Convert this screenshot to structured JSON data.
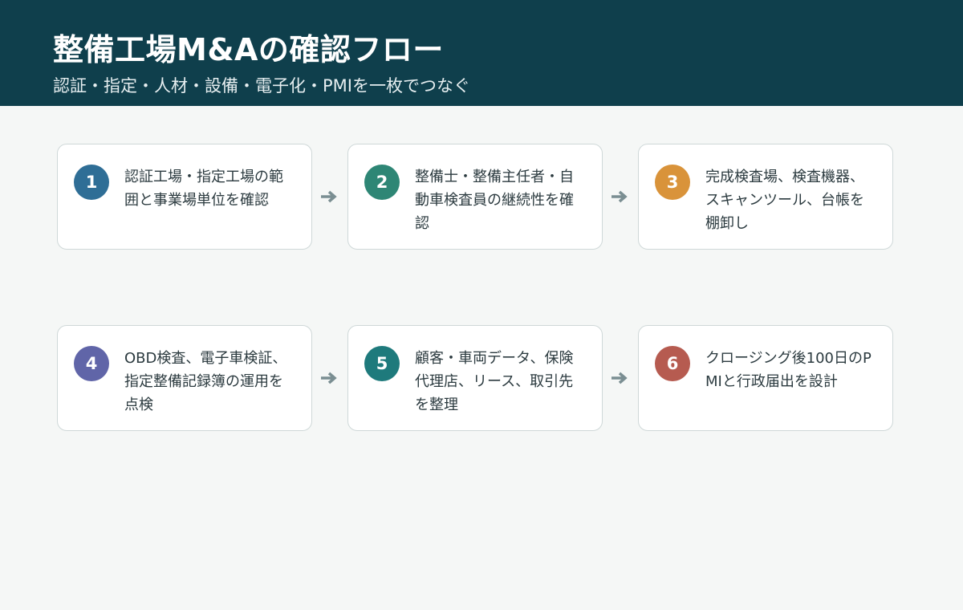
{
  "header": {
    "title": "整備工場M&Aの確認フロー",
    "subtitle": "認証・指定・人材・設備・電子化・PMIを一枚でつなぐ"
  },
  "steps": [
    {
      "number": "1",
      "text": "認証工場・指定工場の範囲と事業場単位を確認",
      "color": "#2f6e96"
    },
    {
      "number": "2",
      "text": "整備士・整備主任者・自動車検査員の継続性を確認",
      "color": "#2e8675"
    },
    {
      "number": "3",
      "text": "完成検査場、検査機器、スキャンツール、台帳を棚卸し",
      "color": "#d9933a"
    },
    {
      "number": "4",
      "text": "OBD検査、電子車検証、指定整備記録簿の運用を点検",
      "color": "#6065a8"
    },
    {
      "number": "5",
      "text": "顧客・車両データ、保険代理店、リース、取引先を整理",
      "color": "#1e7a7c"
    },
    {
      "number": "6",
      "text": "クロージング後100日のPMIと行政届出を設計",
      "color": "#b65b50"
    }
  ],
  "arrow_color": "#7a8e92"
}
